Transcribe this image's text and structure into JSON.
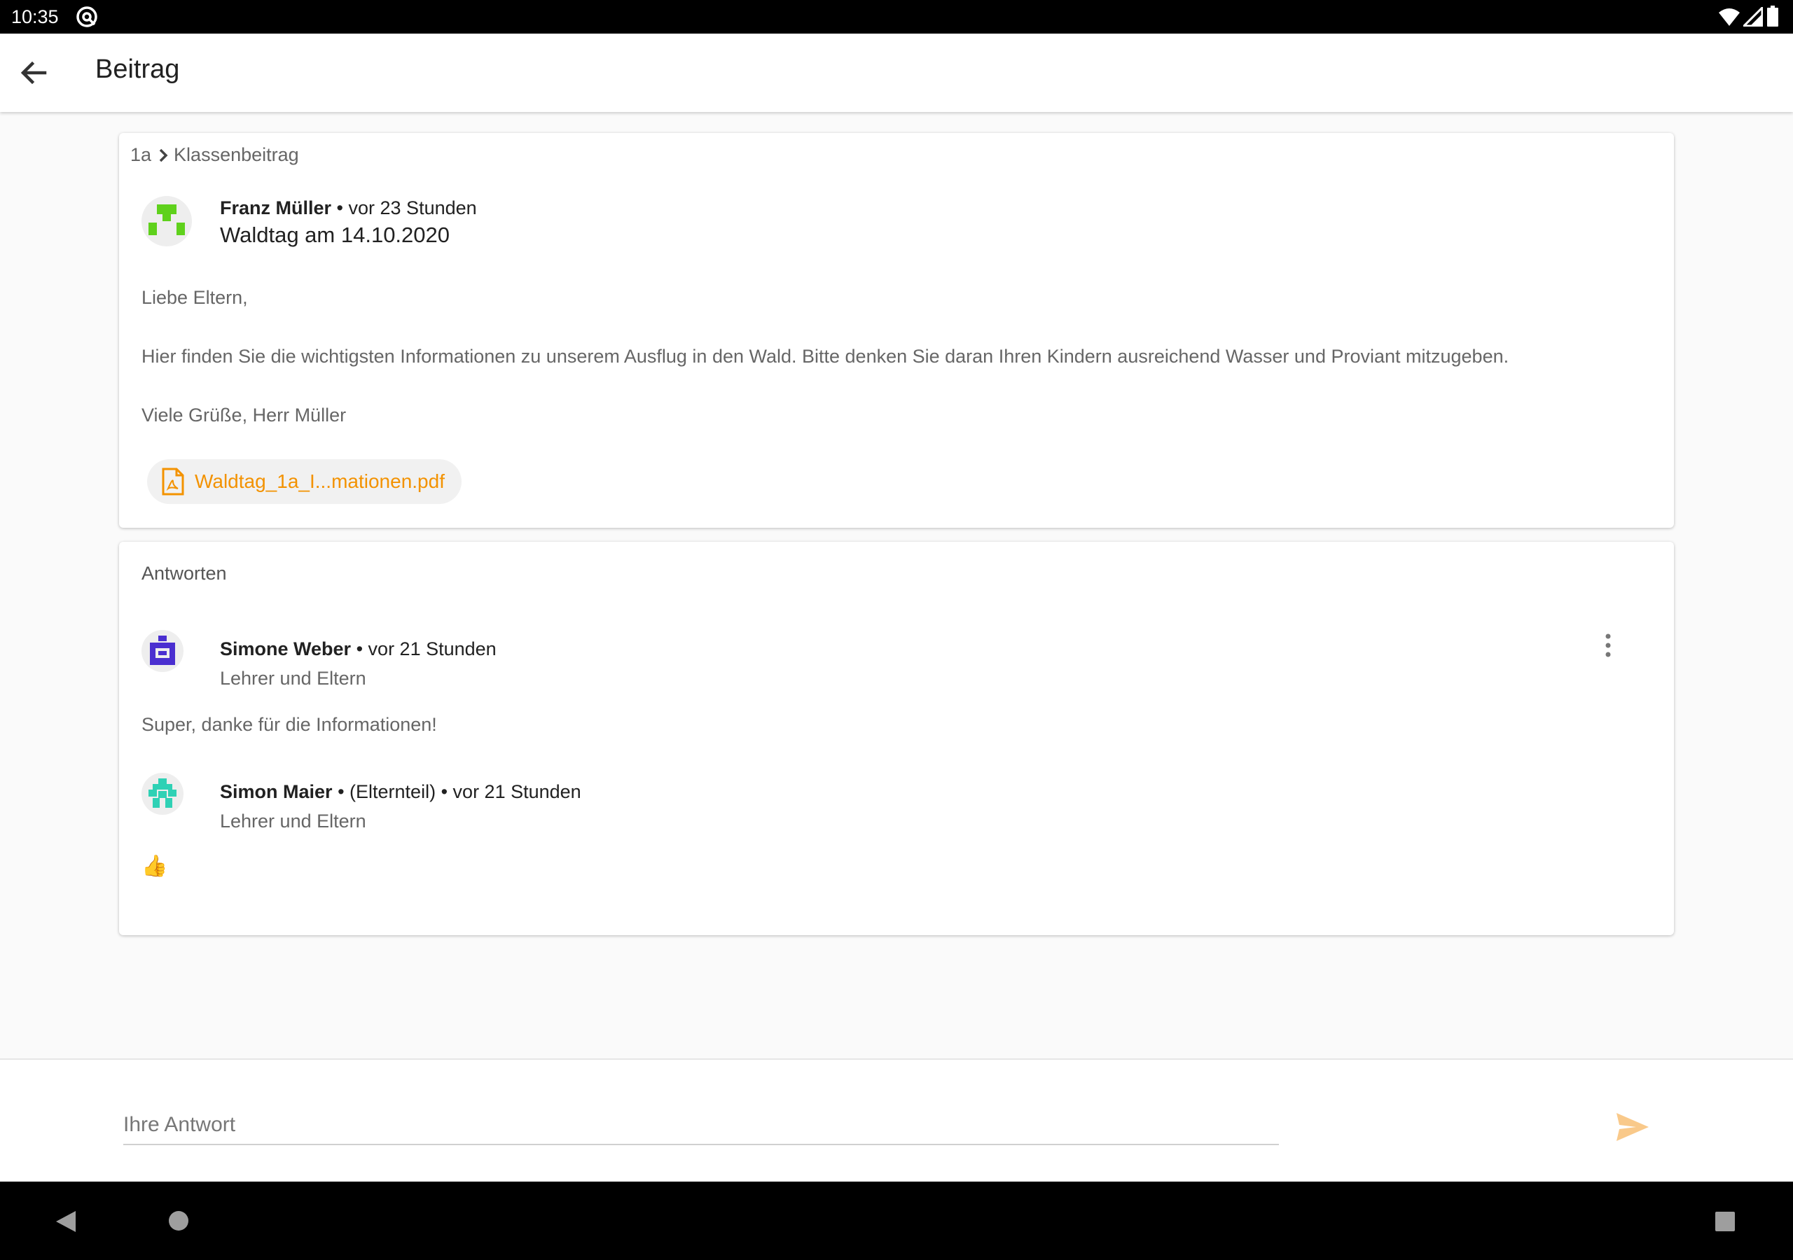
{
  "status_bar": {
    "time": "10:35"
  },
  "app_bar": {
    "title": "Beitrag"
  },
  "post": {
    "breadcrumb_group": "1a",
    "breadcrumb_section": "Klassenbeitrag",
    "author": "Franz Müller",
    "separator": "•",
    "time": "vor 23 Stunden",
    "title": "Waldtag am 14.10.2020",
    "body": [
      "Liebe Eltern,",
      "Hier finden Sie die wichtigsten Informationen zu unserem Ausflug in den Wald. Bitte denken Sie daran Ihren Kindern ausreichend Wasser und Proviant mitzugeben.",
      "Viele Grüße, Herr Müller"
    ],
    "attachment": "Waldtag_1a_I...mationen.pdf"
  },
  "answers": {
    "title": "Antworten",
    "items": [
      {
        "author": "Simone Weber",
        "role_tag": "",
        "separator": "•",
        "time": "vor 21 Stunden",
        "audience": "Lehrer und Eltern",
        "text": "Super, danke für die Informationen!"
      },
      {
        "author": "Simon Maier",
        "role_tag": "(Elternteil)",
        "separator": "•",
        "time": "vor 21 Stunden",
        "audience": "Lehrer und Eltern",
        "text": "👍"
      }
    ]
  },
  "reply": {
    "placeholder": "Ihre Antwort"
  },
  "colors": {
    "accent": "#f39200",
    "send_icon": "#f9c98a",
    "avatar_green": "#5fd11c",
    "avatar_purple": "#4a2fd0",
    "avatar_teal": "#2fd1b5"
  },
  "icons": [
    "sync-icon",
    "wifi-icon",
    "signal-icon",
    "battery-icon",
    "arrow-back-icon",
    "chevron-right-icon",
    "pdf-file-icon",
    "more-vert-icon",
    "send-icon",
    "nav-back-icon",
    "nav-home-icon",
    "nav-recent-icon"
  ]
}
